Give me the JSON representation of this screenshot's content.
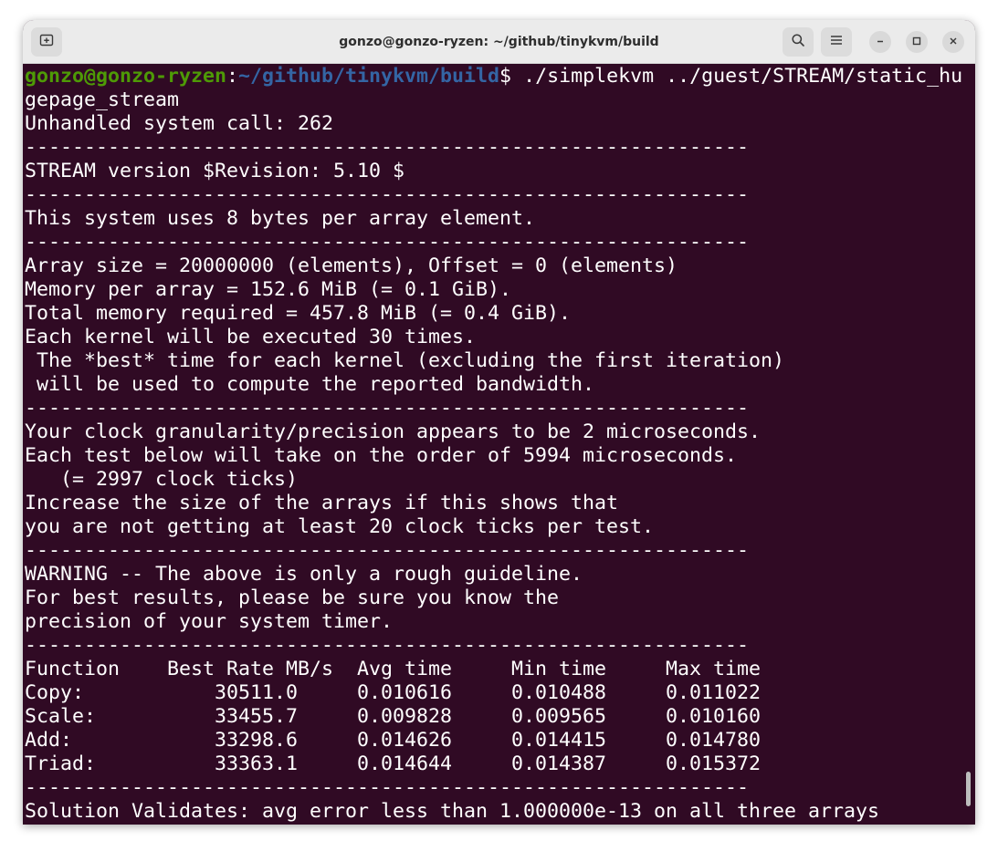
{
  "window": {
    "title": "gonzo@gonzo-ryzen: ~/github/tinykvm/build"
  },
  "titlebar": {
    "new_tab_icon": "new-tab-icon",
    "search_icon": "search-icon",
    "menu_icon": "hamburger-menu-icon",
    "minimize_icon": "minimize-icon",
    "maximize_icon": "maximize-icon",
    "close_icon": "close-icon"
  },
  "colors": {
    "terminal_bg": "#300a24",
    "prompt_user": "#4e9a06",
    "prompt_path": "#3465a4",
    "text": "#ffffff"
  },
  "prompt": {
    "user_host": "gonzo@gonzo-ryzen",
    "colon": ":",
    "path": "~/github/tinykvm/build",
    "symbol": "$",
    "command": " ./simplekvm ../guest/STREAM/static_hu",
    "command_wrap": "gepage_stream"
  },
  "output": {
    "unhandled": "Unhandled system call: 262",
    "separator": "-------------------------------------------------------------",
    "version": "STREAM version $Revision: 5.10 $",
    "bytes_per_element": "This system uses 8 bytes per array element.",
    "array_size": "Array size = 20000000 (elements), Offset = 0 (elements)",
    "memory_per_array": "Memory per array = 152.6 MiB (= 0.1 GiB).",
    "total_memory": "Total memory required = 457.8 MiB (= 0.4 GiB).",
    "kernel_times": "Each kernel will be executed 30 times.",
    "best_time_1": " The *best* time for each kernel (excluding the first iteration)",
    "best_time_2": " will be used to compute the reported bandwidth.",
    "clock_granularity": "Your clock granularity/precision appears to be 2 microseconds.",
    "test_duration": "Each test below will take on the order of 5994 microseconds.",
    "clock_ticks": "   (= 2997 clock ticks)",
    "increase_1": "Increase the size of the arrays if this shows that",
    "increase_2": "you are not getting at least 20 clock ticks per test.",
    "warning_1": "WARNING -- The above is only a rough guideline.",
    "warning_2": "For best results, please be sure you know the",
    "warning_3": "precision of your system timer.",
    "table_header": "Function    Best Rate MB/s  Avg time     Min time     Max time",
    "rows": [
      "Copy:           30511.0     0.010616     0.010488     0.011022",
      "Scale:          33455.7     0.009828     0.009565     0.010160",
      "Add:            33298.6     0.014626     0.014415     0.014780",
      "Triad:          33363.1     0.014644     0.014387     0.015372"
    ],
    "validates": "Solution Validates: avg error less than 1.000000e-13 on all three arrays"
  }
}
